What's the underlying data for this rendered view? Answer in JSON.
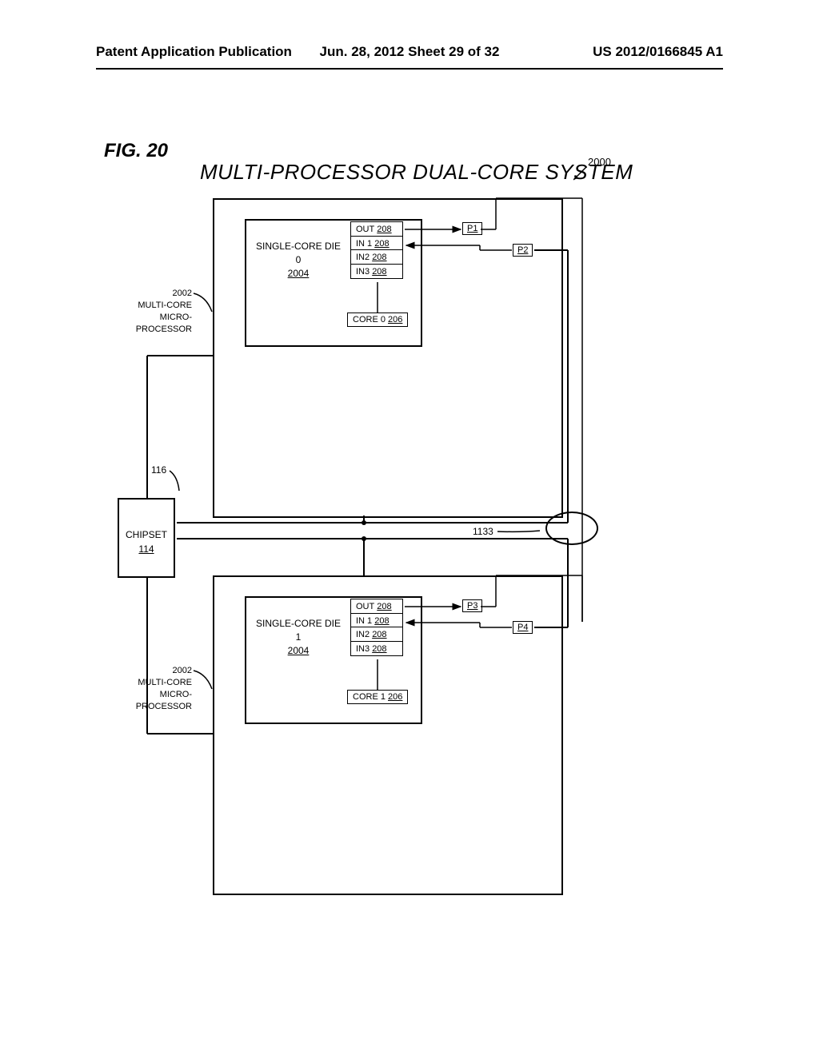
{
  "header": {
    "left": "Patent Application Publication",
    "center": "Jun. 28, 2012  Sheet 29 of 32",
    "right": "US 2012/0166845 A1"
  },
  "figLabel": "FIG. 20",
  "title": "MULTI-PROCESSOR DUAL-CORE SYSTEM",
  "ref2000": "2000",
  "chipset": {
    "label": "CHIPSET",
    "num": "114"
  },
  "bus116": "116",
  "bus1133": "1133",
  "sideLabel": {
    "num": "2002",
    "l1": "MULTI-CORE",
    "l2": "MICRO-",
    "l3": "PROCESSOR"
  },
  "dieTop": {
    "line1": "SINGLE-CORE DIE 0",
    "num": "2004"
  },
  "dieBot": {
    "line1": "SINGLE-CORE DIE 1",
    "num": "2004"
  },
  "io": {
    "out": {
      "label": "OUT",
      "num": "208"
    },
    "in1": {
      "label": "IN 1",
      "num": "208"
    },
    "in2": {
      "label": "IN2",
      "num": "208"
    },
    "in3": {
      "label": "IN3",
      "num": "208"
    }
  },
  "coreTop": {
    "label": "CORE 0",
    "num": "206"
  },
  "coreBot": {
    "label": "CORE 1",
    "num": "206"
  },
  "pins": {
    "p1": "P1",
    "p2": "P2",
    "p3": "P3",
    "p4": "P4"
  }
}
